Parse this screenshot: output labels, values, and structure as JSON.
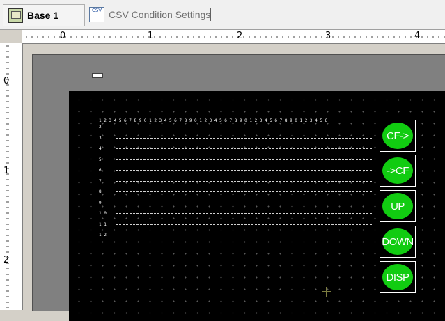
{
  "tabs": [
    {
      "label": "Base 1",
      "icon": "base-screen-icon",
      "active": true
    },
    {
      "label": "CSV Condition Settings",
      "icon": "csv-settings-icon",
      "active": false
    }
  ],
  "ruler": {
    "h_labels": [
      "0",
      "1",
      "2",
      "3",
      "4"
    ],
    "v_labels": [
      "0",
      "1",
      "2"
    ]
  },
  "grid": {
    "header": "1234567890123456789012345678901234567890123456",
    "row_numbers": [
      "2",
      "3",
      "4",
      "5",
      "6",
      "7",
      "8",
      "9",
      "10",
      "11",
      "12"
    ]
  },
  "buttons": [
    {
      "label": "CF->"
    },
    {
      "label": "->CF"
    },
    {
      "label": "UP"
    },
    {
      "label": "DOWN"
    },
    {
      "label": "DISP"
    }
  ],
  "colors": {
    "button_green": "#11cc11",
    "screen_bg": "#000000",
    "frame_gray": "#808080"
  }
}
